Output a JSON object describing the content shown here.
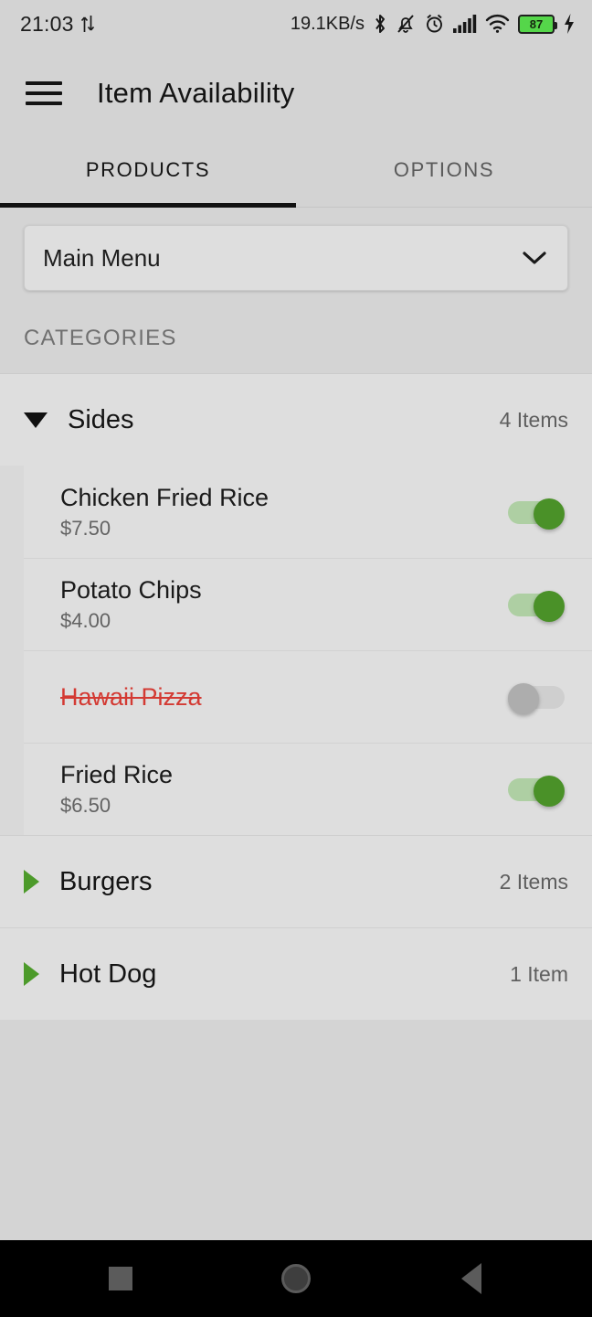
{
  "status_bar": {
    "time": "21:03",
    "data_transfer_icon": "up-down-arrows-icon",
    "network_speed": "19.1KB/s",
    "icons": [
      "bluetooth-icon",
      "notifications-muted-icon",
      "alarm-icon",
      "cellular-signal-icon",
      "wifi-icon"
    ],
    "battery_level": "87",
    "battery_color": "#55d64a",
    "charging_icon": "lightning-bolt-icon"
  },
  "app_bar": {
    "menu_icon": "hamburger-menu-icon",
    "title": "Item Availability"
  },
  "tabs": {
    "items": [
      {
        "label": "PRODUCTS",
        "active": true
      },
      {
        "label": "OPTIONS",
        "active": false
      }
    ],
    "indicator_color": "#121212"
  },
  "menu_selector": {
    "value": "Main Menu",
    "chevron_icon": "chevron-down-icon"
  },
  "categories_header": "CATEGORIES",
  "categories": [
    {
      "name": "Sides",
      "count": "4 Items",
      "expanded": true,
      "expand_icon": "triangle-down-icon",
      "products": [
        {
          "name": "Chicken Fried Rice",
          "price": "$7.50",
          "available": true,
          "toggle_state": "on"
        },
        {
          "name": "Potato Chips",
          "price": "$4.00",
          "available": true,
          "toggle_state": "on"
        },
        {
          "name": "Hawaii Pizza",
          "price": "",
          "available": false,
          "toggle_state": "off"
        },
        {
          "name": "Fried Rice",
          "price": "$6.50",
          "available": true,
          "toggle_state": "on"
        }
      ]
    },
    {
      "name": "Burgers",
      "count": "2 Items",
      "expanded": false,
      "expand_icon": "triangle-right-icon",
      "products": []
    },
    {
      "name": "Hot Dog",
      "count": "1 Item",
      "expanded": false,
      "expand_icon": "triangle-right-icon",
      "products": []
    }
  ],
  "colors": {
    "toggle_on_thumb": "#4a9128",
    "toggle_on_track": "#aecfa3",
    "toggle_off_thumb": "#adadad",
    "unavailable_text": "#d33a33",
    "collapsed_triangle": "#4c9a2a",
    "page_background": "#d4d4d4"
  },
  "nav_bar": {
    "buttons": [
      {
        "name": "recents-button",
        "icon": "square-icon"
      },
      {
        "name": "home-button",
        "icon": "circle-icon"
      },
      {
        "name": "back-button",
        "icon": "triangle-left-icon"
      }
    ]
  }
}
